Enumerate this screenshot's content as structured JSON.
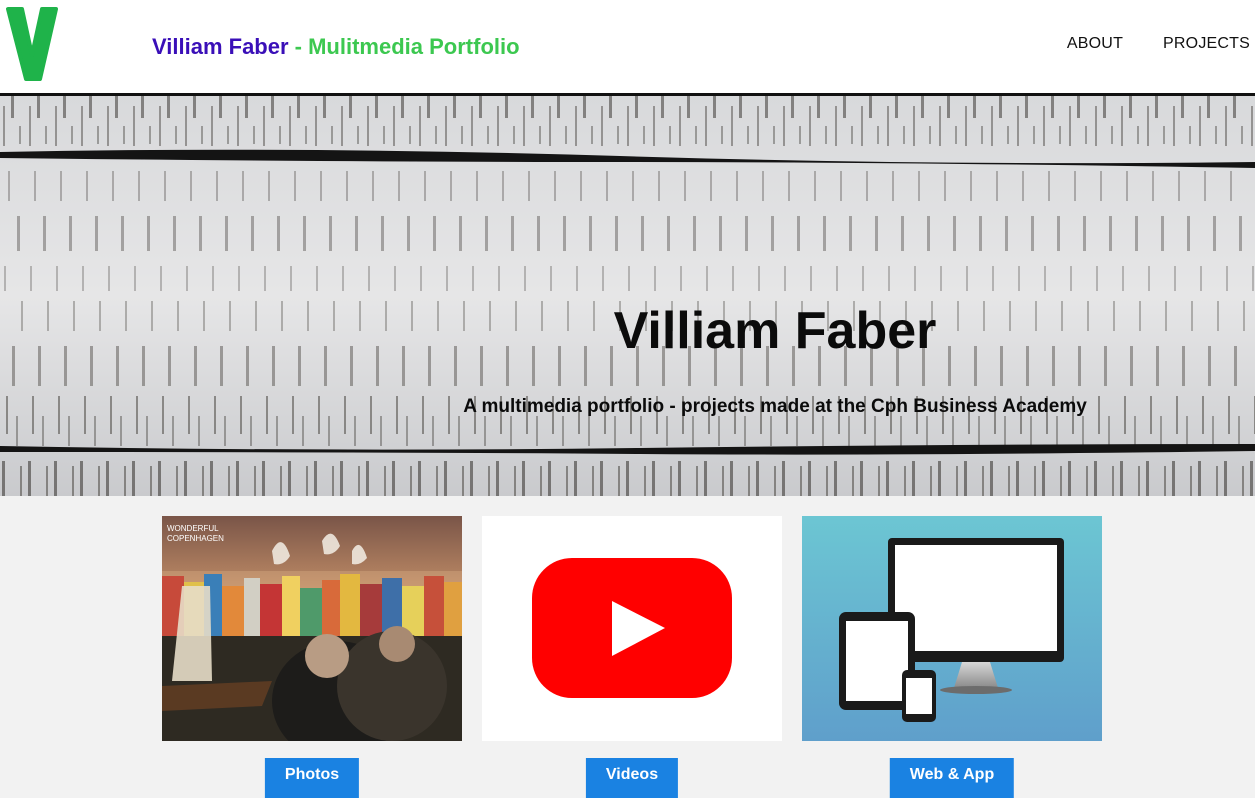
{
  "header": {
    "logo_letter": "V",
    "title_name": "Villiam Faber",
    "title_separator": " - ",
    "title_subtitle": "Mulitmedia Portfolio",
    "nav": [
      {
        "label": "ABOUT"
      },
      {
        "label": "PROJECTS"
      }
    ]
  },
  "hero": {
    "title": "Villiam Faber",
    "subtitle": "A multimedia portfolio - projects made at the Cph Business Academy"
  },
  "cards": [
    {
      "button_label": "Photos",
      "image_caption": "WONDERFUL COPENHAGEN",
      "image_kind": "photo-collage"
    },
    {
      "button_label": "Videos",
      "image_kind": "youtube-icon"
    },
    {
      "button_label": "Web & App",
      "image_kind": "devices-icon"
    }
  ],
  "colors": {
    "title_name": "#3a0fb8",
    "title_subtitle": "#3cc850",
    "logo_green": "#1fb34a",
    "button_blue": "#1a82e2",
    "youtube_red": "#ff0000",
    "devices_bg": "#5cb6cc"
  }
}
